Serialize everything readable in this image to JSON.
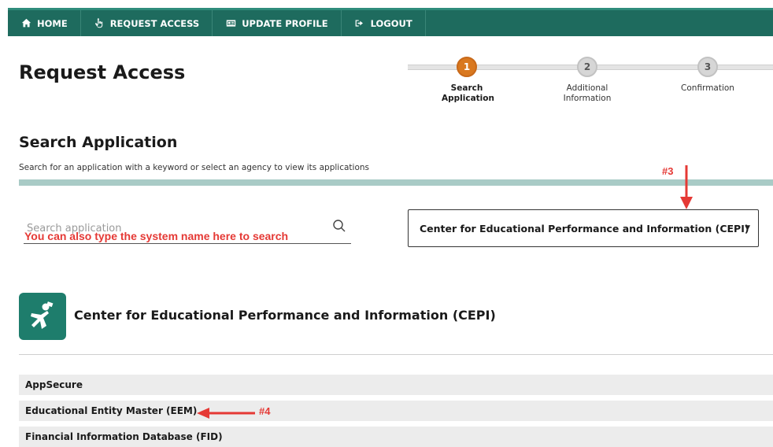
{
  "nav": {
    "items": [
      {
        "label": "HOME",
        "icon": "home-icon"
      },
      {
        "label": "REQUEST ACCESS",
        "icon": "pointer-hand-icon"
      },
      {
        "label": "UPDATE PROFILE",
        "icon": "id-card-icon"
      },
      {
        "label": "LOGOUT",
        "icon": "logout-icon"
      }
    ]
  },
  "page": {
    "title": "Request Access"
  },
  "stepper": {
    "steps": [
      {
        "number": "1",
        "label": "Search Application",
        "active": true
      },
      {
        "number": "2",
        "label": "Additional Information",
        "active": false
      },
      {
        "number": "3",
        "label": "Confirmation",
        "active": false
      }
    ]
  },
  "section": {
    "title": "Search Application",
    "subtitle": "Search for an application with a keyword or select an agency to view its applications"
  },
  "search": {
    "placeholder": "Search application",
    "value": ""
  },
  "agency_select": {
    "selected": "Center for Educational Performance and Information (CEPI)"
  },
  "agency": {
    "name": "Center for Educational Performance and Information (CEPI)"
  },
  "applications": [
    "AppSecure",
    "Educational Entity Master (EEM)",
    "Financial Information Database (FID)"
  ],
  "annotations": {
    "search_hint": "You can also type the system name here to search",
    "marker_3": "#3",
    "marker_4": "#4"
  },
  "colors": {
    "nav_bg": "#1e6b5e",
    "active_step": "#d9781f",
    "annotation": "#e53935",
    "rule": "#a9cbc6",
    "logo_bg": "#1e7d6c"
  }
}
